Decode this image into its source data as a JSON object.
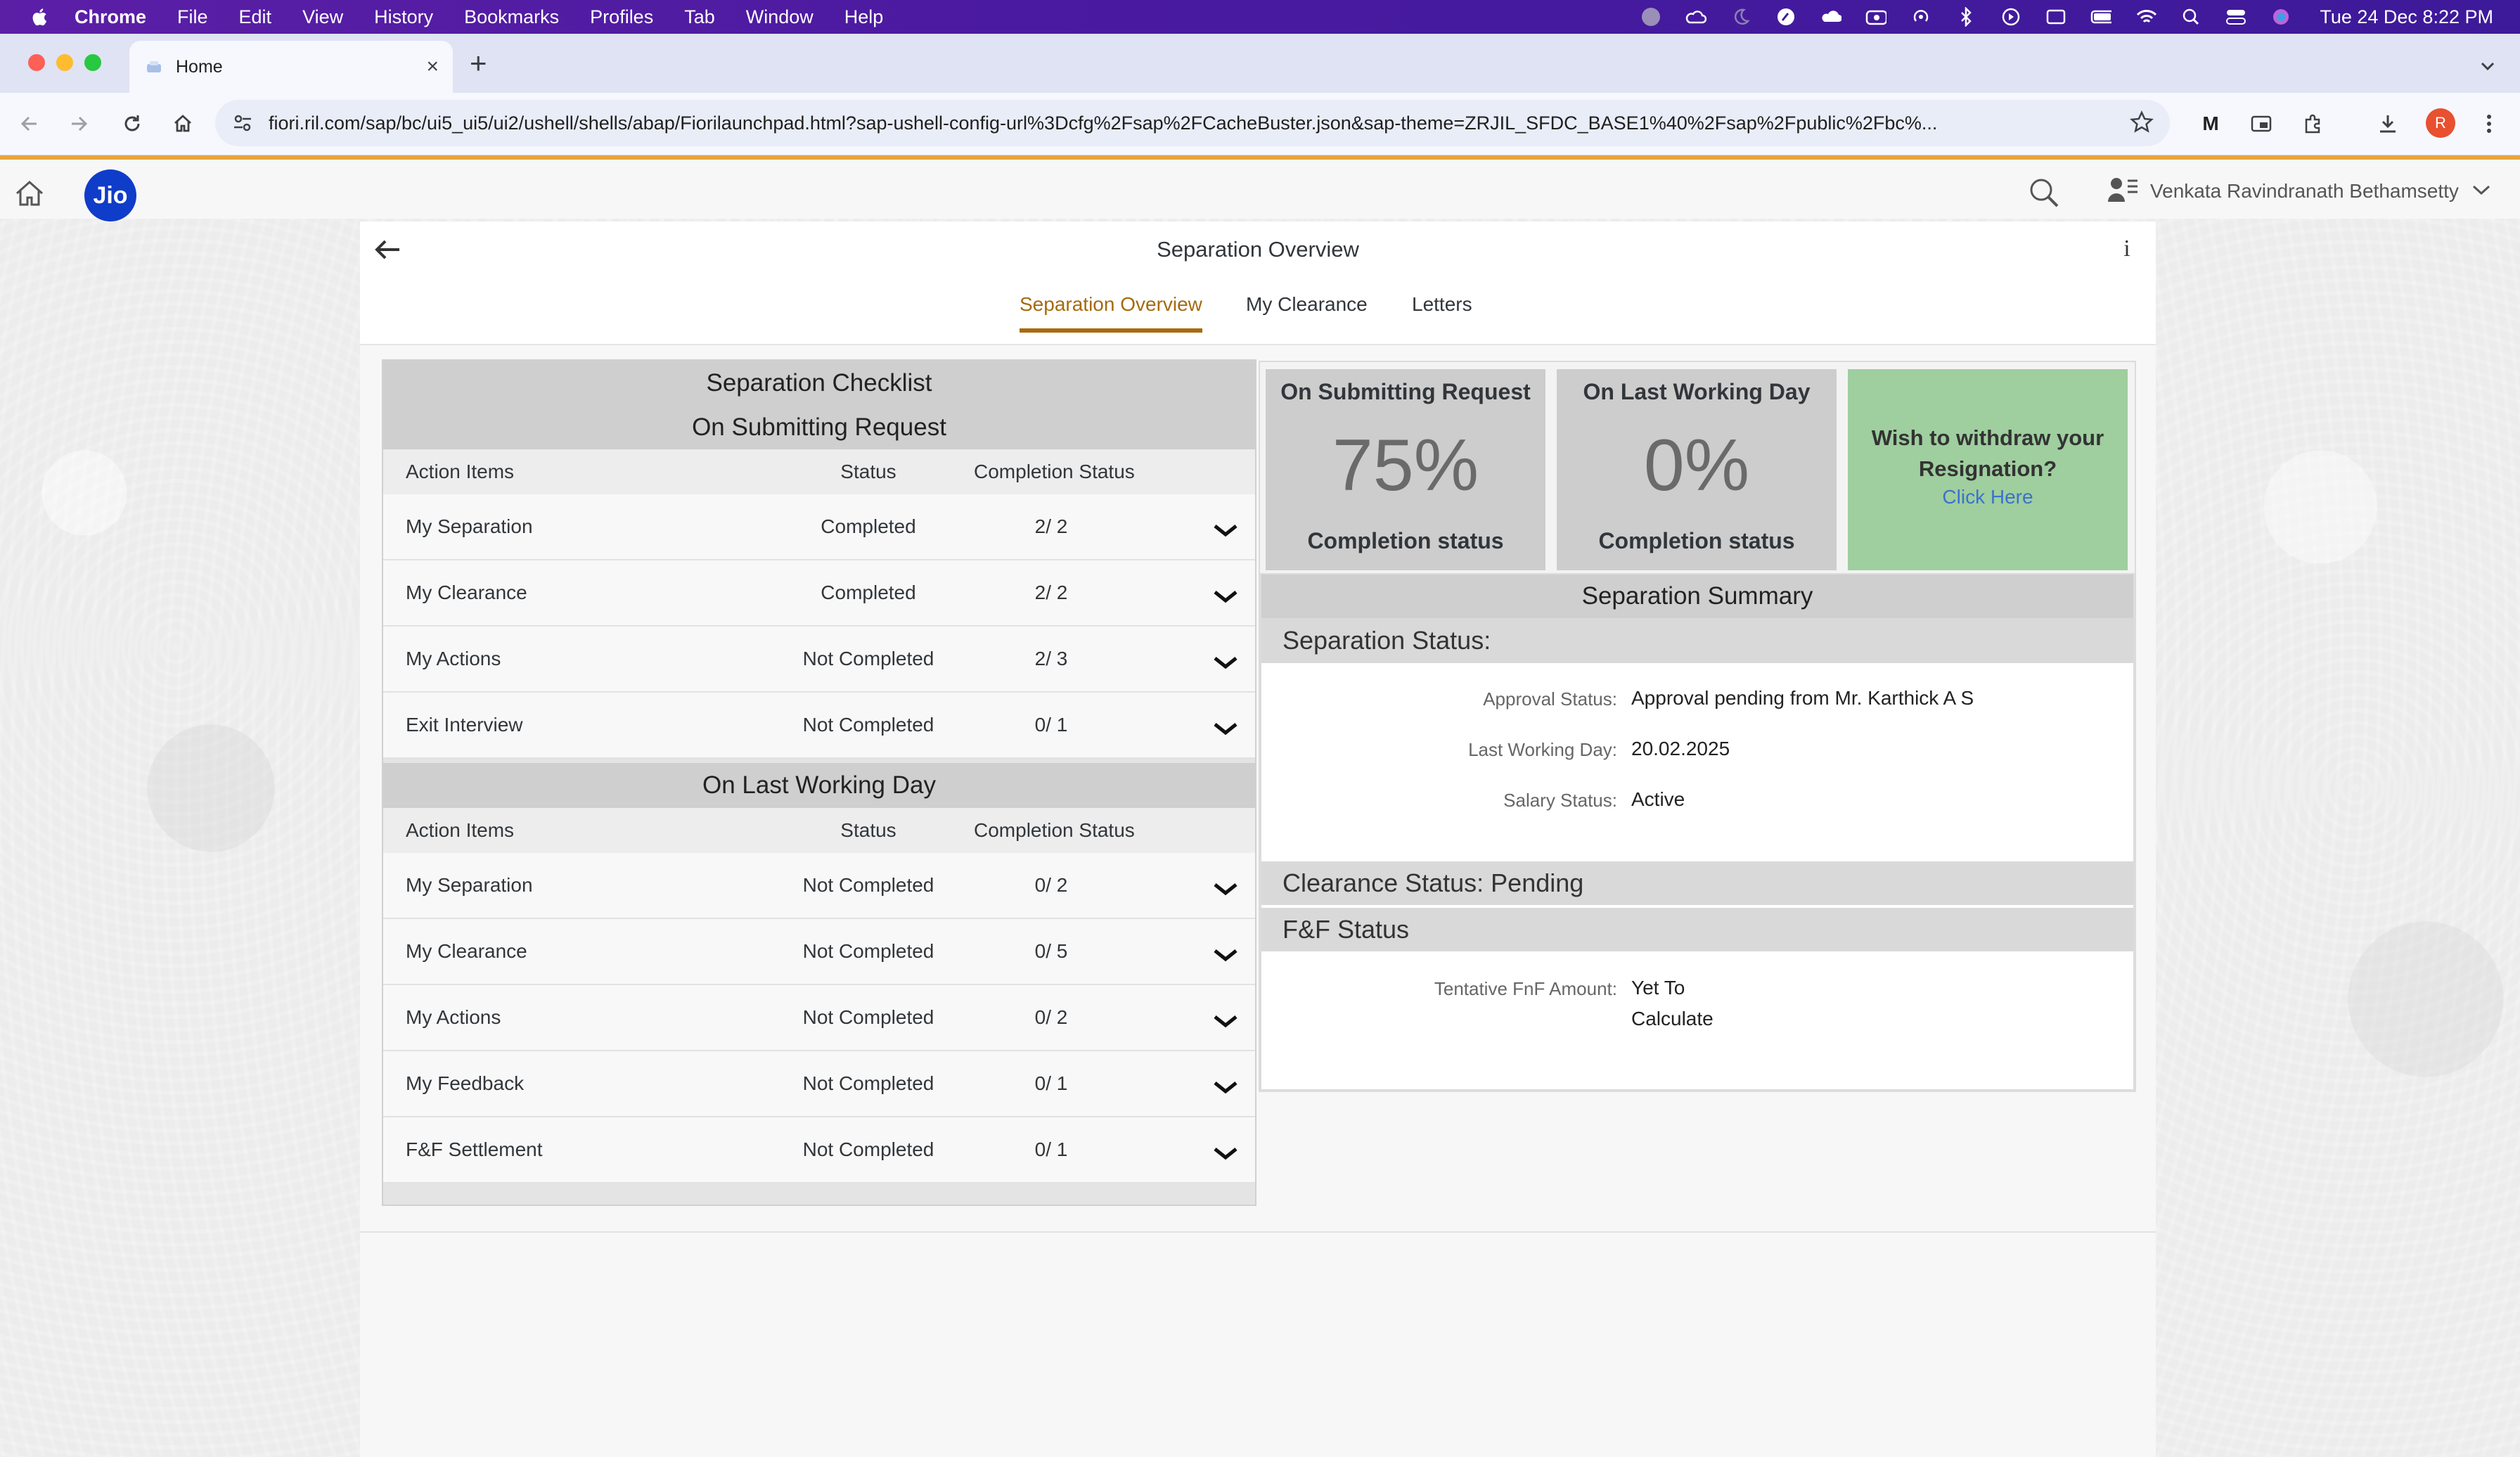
{
  "menubar": {
    "app_name": "Chrome",
    "items": [
      "File",
      "Edit",
      "View",
      "History",
      "Bookmarks",
      "Profiles",
      "Tab",
      "Window",
      "Help"
    ],
    "clock": "Tue 24 Dec  8:22 PM"
  },
  "browser": {
    "tab_title": "Home",
    "url": "fiori.ril.com/sap/bc/ui5_ui5/ui2/ushell/shells/abap/Fiorilaunchpad.html?sap-ushell-config-url%3Dcfg%2Fsap%2FCacheBuster.json&sap-theme=ZRJIL_SFDC_BASE1%40%2Fsap%2Fpublic%2Fbc%...",
    "profile_initial": "R",
    "extension_m": "M"
  },
  "shell": {
    "logo_text": "Jio",
    "user_name": "Venkata Ravindranath Bethamsetty"
  },
  "app": {
    "title": "Separation Overview",
    "info": "i",
    "tabs": [
      "Separation Overview",
      "My Clearance",
      "Letters"
    ]
  },
  "checklist": {
    "title": "Separation Checklist",
    "columns": {
      "item": "Action Items",
      "status": "Status",
      "completion": "Completion Status"
    },
    "submitting": {
      "title": "On Submitting Request",
      "rows": [
        {
          "item": "My Separation",
          "status": "Completed",
          "completion": "2/ 2"
        },
        {
          "item": "My Clearance",
          "status": "Completed",
          "completion": "2/ 2"
        },
        {
          "item": "My Actions",
          "status": "Not Completed",
          "completion": "2/ 3"
        },
        {
          "item": "Exit Interview",
          "status": "Not Completed",
          "completion": "0/ 1"
        }
      ]
    },
    "last_day": {
      "title": "On Last Working Day",
      "rows": [
        {
          "item": "My Separation",
          "status": "Not Completed",
          "completion": "0/ 2"
        },
        {
          "item": "My Clearance",
          "status": "Not Completed",
          "completion": "0/ 5"
        },
        {
          "item": "My Actions",
          "status": "Not Completed",
          "completion": "0/ 2"
        },
        {
          "item": "My Feedback",
          "status": "Not Completed",
          "completion": "0/ 1"
        },
        {
          "item": "F&F Settlement",
          "status": "Not Completed",
          "completion": "0/ 1"
        }
      ]
    }
  },
  "cards": {
    "submitting": {
      "title": "On Submitting Request",
      "percent": "75%",
      "subtitle": "Completion status"
    },
    "last_day": {
      "title": "On Last Working Day",
      "percent": "0%",
      "subtitle": "Completion status"
    },
    "withdraw": {
      "text": "Wish to withdraw your Resignation?",
      "link": "Click Here"
    }
  },
  "summary": {
    "title": "Separation Summary",
    "status_head": "Separation Status:",
    "approval_label": "Approval Status:",
    "approval_value": "Approval pending from Mr. Karthick A S",
    "lwd_label": "Last Working Day:",
    "lwd_value": "20.02.2025",
    "salary_label": "Salary Status:",
    "salary_value": "Active",
    "clearance_head": "Clearance Status: Pending",
    "fnf_head": "F&F Status",
    "fnf_label": "Tentative FnF Amount:",
    "fnf_value_line1": "Yet To",
    "fnf_value_line2": "Calculate"
  },
  "colors": {
    "menubar": "#4a1aa0",
    "accent_tab": "#a66a0e",
    "withdraw_card": "#9fce9f",
    "stat_card": "#cdcdcd",
    "jio_blue": "#0f3cc9"
  }
}
